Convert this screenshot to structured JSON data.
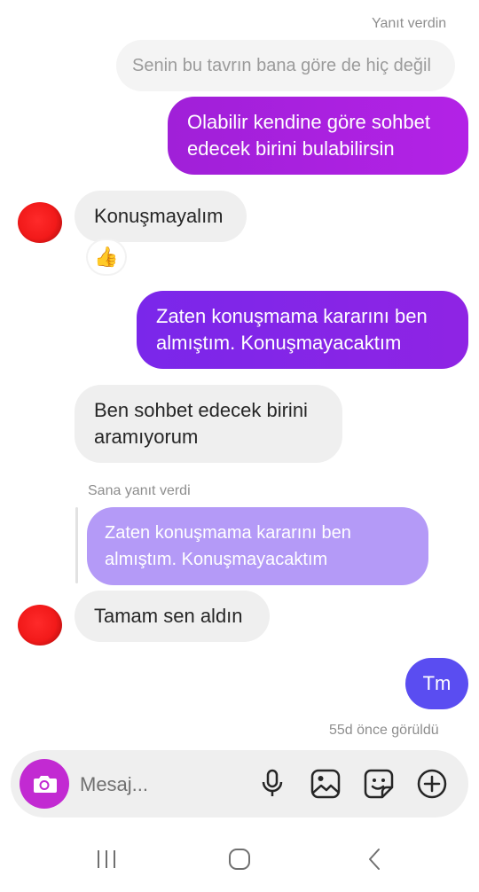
{
  "reply_header_top": "Yanıt verdin",
  "messages": [
    {
      "text": "Senin bu tavrın bana göre de hiç değil"
    },
    {
      "text": "Olabilir kendine göre sohbet edecek birini bulabilirsin"
    },
    {
      "text": "Konuşmayalım",
      "reaction": "👍"
    },
    {
      "text": "Zaten konuşmama kararını ben almıştım. Konuşmayacaktım"
    },
    {
      "text": "Ben sohbet edecek birini aramıyorum"
    },
    {
      "text": "Zaten konuşmama kararını ben almıştım. Konuşmayacaktım"
    },
    {
      "text": "Tamam sen aldın"
    },
    {
      "text": "Tm"
    }
  ],
  "reply_header_incoming": "Sana yanıt verdi",
  "seen_status": "55d önce görüldü",
  "composer": {
    "placeholder": "Mesaj...",
    "icons": [
      "camera-icon",
      "microphone-icon",
      "gallery-icon",
      "sticker-icon",
      "plus-icon"
    ]
  },
  "system_nav": [
    "recent-apps-icon",
    "home-icon",
    "back-icon"
  ],
  "colors": {
    "outgoing_gradient_start": "#a020d8",
    "outgoing_gradient_mid": "#7a27ea",
    "outgoing_latest": "#5a4df1",
    "reply_quote": "#b49af7",
    "incoming": "#efefef",
    "camera_button": "#c22ad2"
  }
}
